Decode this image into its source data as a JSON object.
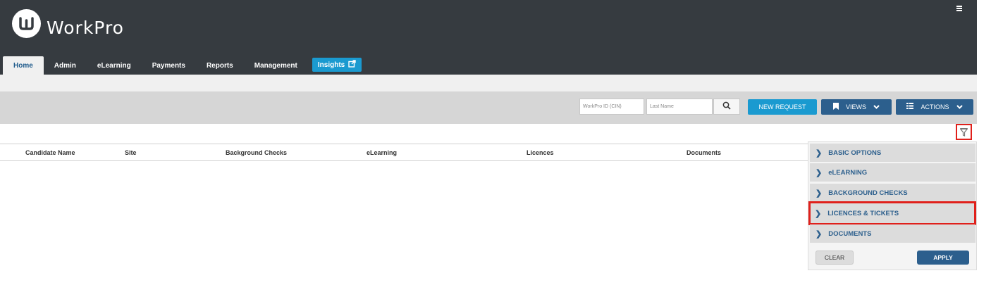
{
  "app": {
    "name": "WorkPro"
  },
  "nav": {
    "tabs": [
      {
        "label": "Home"
      },
      {
        "label": "Admin"
      },
      {
        "label": "eLearning"
      },
      {
        "label": "Payments"
      },
      {
        "label": "Reports"
      },
      {
        "label": "Management"
      },
      {
        "label": "Insights"
      }
    ],
    "active_tab": "Home"
  },
  "toolbar": {
    "cin_placeholder": "WorkPro ID (CIN)",
    "lastname_placeholder": "Last Name",
    "new_request_label": "NEW REQUEST",
    "views_label": "VIEWS",
    "actions_label": "ACTIONS"
  },
  "table": {
    "columns": [
      "Candidate Name",
      "Site",
      "Background Checks",
      "eLearning",
      "Licences",
      "Documents"
    ]
  },
  "filter_panel": {
    "sections": [
      {
        "label": "BASIC OPTIONS"
      },
      {
        "label": "eLEARNING"
      },
      {
        "label": "BACKGROUND CHECKS"
      },
      {
        "label": "LICENCES & TICKETS"
      },
      {
        "label": "DOCUMENTS"
      }
    ],
    "clear_label": "CLEAR",
    "apply_label": "APPLY"
  },
  "icons": {
    "logo": "workpro-logo-icon",
    "menu": "hamburger-icon",
    "external": "external-link-icon",
    "search": "search-icon",
    "views": "bookmark-icon",
    "actions": "grid-icon",
    "filter": "filter-icon",
    "chevron": "chevron-right-icon"
  },
  "colors": {
    "header_bg": "#363b40",
    "accent_teal": "#1a9ad0",
    "accent_navy": "#2c5f8d",
    "highlight_red": "#e0201b"
  }
}
